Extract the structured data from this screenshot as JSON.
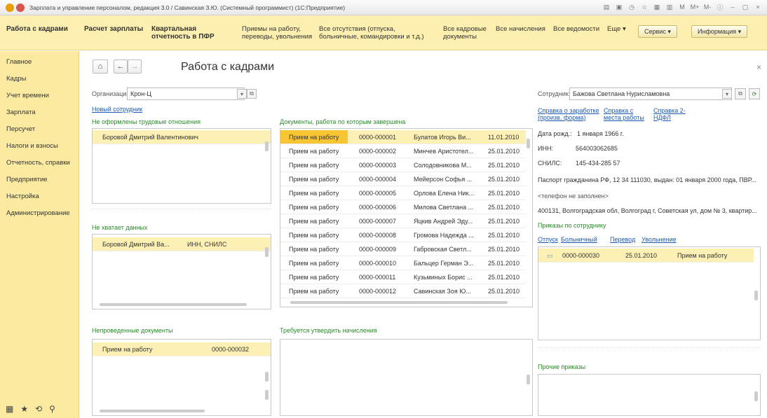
{
  "window": {
    "title": "Зарплата и управление персоналом, редакция 3.0 / Савинская З.Ю. (Системный программист) (1С:Предприятие)",
    "toolbar_buttons": [
      "M",
      "M+",
      "M-"
    ]
  },
  "menubar": {
    "items": [
      "Работа с кадрами",
      "Расчет зарплаты",
      "Квартальная отчетность в ПФР",
      "Приемы на работу, переводы, увольнения",
      "Все отсутствия (отпуска, больничные, командировки и т.д.)",
      "Все кадровые документы",
      "Все начисления",
      "Все ведомости",
      "Еще ▾"
    ],
    "service_label": "Сервис ▾",
    "info_label": "Информация ▾"
  },
  "sidebar": {
    "items": [
      "Главное",
      "Кадры",
      "Учет времени",
      "Зарплата",
      "Персучет",
      "Налоги и взносы",
      "Отчетность, справки",
      "Предприятие",
      "Настройка",
      "Администрирование"
    ]
  },
  "page": {
    "title": "Работа с кадрами",
    "organization_label": "Организация:",
    "organization_value": "Крон-Ц",
    "new_employee_link": "Новый сотрудник",
    "employee_label": "Сотрудник:",
    "employee_value": "Бажова Светлана Нурисламовна"
  },
  "sections": {
    "not_registered": {
      "title": "Не оформлены трудовые отношения",
      "rows": [
        "Боровой Дмитрий Валентинович"
      ]
    },
    "missing_data": {
      "title": "Не хватает данных",
      "rows": [
        {
          "name": "Боровой Дмитрий Ва...",
          "what": "ИНН, СНИЛС"
        }
      ]
    },
    "unposted": {
      "title": "Непроведенные документы",
      "rows": [
        {
          "doc": "Прием на работу",
          "number": "0000-000032"
        }
      ]
    },
    "finished_docs": {
      "title": "Документы, работа по которым завершена",
      "rows": [
        {
          "doc": "Прием на работу",
          "number": "0000-000001",
          "name": "Булатов Игорь Ви...",
          "date": "11.01.2010"
        },
        {
          "doc": "Прием на работу",
          "number": "0000-000002",
          "name": "Минчев Аристотел...",
          "date": "25.01.2010"
        },
        {
          "doc": "Прием на работу",
          "number": "0000-000003",
          "name": "Солодовникова М...",
          "date": "25.01.2010"
        },
        {
          "doc": "Прием на работу",
          "number": "0000-000004",
          "name": "Мейерсон Софья ...",
          "date": "25.01.2010"
        },
        {
          "doc": "Прием на работу",
          "number": "0000-000005",
          "name": "Орлова Елена Ник...",
          "date": "25.01.2010"
        },
        {
          "doc": "Прием на работу",
          "number": "0000-000006",
          "name": "Милова Светлана ...",
          "date": "25.01.2010"
        },
        {
          "doc": "Прием на работу",
          "number": "0000-000007",
          "name": "Яцкив Андрей Эду...",
          "date": "25.01.2010"
        },
        {
          "doc": "Прием на работу",
          "number": "0000-000008",
          "name": "Громова Надежда ...",
          "date": "25.01.2010"
        },
        {
          "doc": "Прием на работу",
          "number": "0000-000009",
          "name": "Габровская Светл...",
          "date": "25.01.2010"
        },
        {
          "doc": "Прием на работу",
          "number": "0000-000010",
          "name": "Бальцер Герман Э...",
          "date": "25.01.2010"
        },
        {
          "doc": "Прием на работу",
          "number": "0000-000011",
          "name": "Кузьминых Борис ...",
          "date": "25.01.2010"
        },
        {
          "doc": "Прием на работу",
          "number": "0000-000012",
          "name": "Савинская Зоя Ю...",
          "date": "25.01.2010"
        }
      ]
    },
    "approve": {
      "title": "Требуется утвердить начисления"
    },
    "employee_card": {
      "links": [
        "Справка о заработке (произв. форма)",
        "Справка с места работы",
        "Справка 2-НДФЛ"
      ],
      "birth_label": "Дата рожд.:",
      "birth_value": "1 января 1966 г.",
      "inn_label": "ИНН:",
      "inn_value": "564003062685",
      "snils_label": "СНИЛС:",
      "snils_value": "145-434-285 57",
      "passport": "Паспорт гражданина РФ,  12 34 111030, выдан: 01 января 2000 года, ПВР...",
      "phone": "<телефон не заполнен>",
      "address": "400131, Волгоградская обл, Волгоград г, Советская ул, дом № 3, квартир..."
    },
    "orders": {
      "title": "Приказы по сотруднику",
      "links": [
        "Отпуск",
        "Больничный",
        "Перевод",
        "Увольнение"
      ],
      "rows": [
        {
          "number": "0000-000030",
          "date": "25.01.2010",
          "doc": "Прием на работу"
        }
      ]
    },
    "other_orders": {
      "title": "Прочие приказы"
    }
  }
}
